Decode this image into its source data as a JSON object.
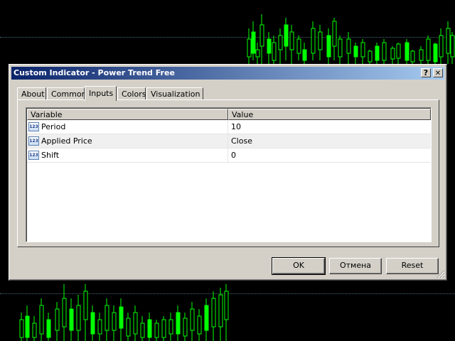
{
  "dialog": {
    "title": "Custom Indicator - Power Trend Free",
    "help_label": "?",
    "close_label": "✕"
  },
  "tabs": [
    {
      "label": "About"
    },
    {
      "label": "Common"
    },
    {
      "label": "Inputs"
    },
    {
      "label": "Colors"
    },
    {
      "label": "Visualization"
    }
  ],
  "active_tab": "Inputs",
  "table": {
    "headers": [
      "Variable",
      "Value"
    ],
    "rows": [
      {
        "icon": "numeric-input-icon",
        "icon_text": "123",
        "variable": "Period",
        "value": "10"
      },
      {
        "icon": "numeric-input-icon",
        "icon_text": "123",
        "variable": "Applied Price",
        "value": "Close"
      },
      {
        "icon": "numeric-input-icon",
        "icon_text": "123",
        "variable": "Shift",
        "value": "0"
      }
    ]
  },
  "buttons": {
    "ok": "OK",
    "cancel": "Отмена",
    "reset": "Reset"
  },
  "colors": {
    "chart_background": "#000000",
    "candle_color": "#00ff00",
    "title_gradient_start": "#0a246a",
    "title_gradient_end": "#a6caf0",
    "dialog_face": "#d4d0c8"
  }
}
